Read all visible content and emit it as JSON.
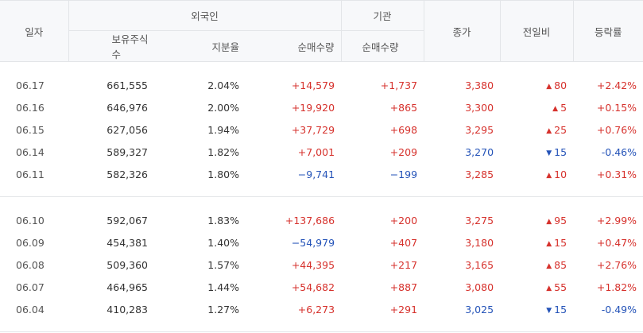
{
  "header": {
    "date": "일자",
    "foreign": "외국인",
    "institution": "기관",
    "close": "종가",
    "change": "전일비",
    "rate": "등락률",
    "holdings": "보유주식수",
    "share_ratio": "지분율",
    "foreign_net": "순매수량",
    "inst_net": "순매수량"
  },
  "colors": {
    "up": "#d6312c",
    "down": "#2453b8"
  },
  "icons": {
    "up": "triangle-up-icon",
    "down": "triangle-down-icon"
  },
  "groups": [
    {
      "rows": [
        {
          "date": "06.17",
          "holdings": "661,555",
          "ratio": "2.04%",
          "foreign_net": "+14,579",
          "fdir": "up",
          "inst_net": "+1,737",
          "idir": "up",
          "close": "3,380",
          "cdir": "up",
          "change": "80",
          "chdir": "up",
          "rate": "+2.42%",
          "rdir": "up"
        },
        {
          "date": "06.16",
          "holdings": "646,976",
          "ratio": "2.00%",
          "foreign_net": "+19,920",
          "fdir": "up",
          "inst_net": "+865",
          "idir": "up",
          "close": "3,300",
          "cdir": "up",
          "change": "5",
          "chdir": "up",
          "rate": "+0.15%",
          "rdir": "up"
        },
        {
          "date": "06.15",
          "holdings": "627,056",
          "ratio": "1.94%",
          "foreign_net": "+37,729",
          "fdir": "up",
          "inst_net": "+698",
          "idir": "up",
          "close": "3,295",
          "cdir": "up",
          "change": "25",
          "chdir": "up",
          "rate": "+0.76%",
          "rdir": "up"
        },
        {
          "date": "06.14",
          "holdings": "589,327",
          "ratio": "1.82%",
          "foreign_net": "+7,001",
          "fdir": "up",
          "inst_net": "+209",
          "idir": "up",
          "close": "3,270",
          "cdir": "down",
          "change": "15",
          "chdir": "down",
          "rate": "-0.46%",
          "rdir": "down"
        },
        {
          "date": "06.11",
          "holdings": "582,326",
          "ratio": "1.80%",
          "foreign_net": "−9,741",
          "fdir": "down",
          "inst_net": "−199",
          "idir": "down",
          "close": "3,285",
          "cdir": "up",
          "change": "10",
          "chdir": "up",
          "rate": "+0.31%",
          "rdir": "up"
        }
      ]
    },
    {
      "rows": [
        {
          "date": "06.10",
          "holdings": "592,067",
          "ratio": "1.83%",
          "foreign_net": "+137,686",
          "fdir": "up",
          "inst_net": "+200",
          "idir": "up",
          "close": "3,275",
          "cdir": "up",
          "change": "95",
          "chdir": "up",
          "rate": "+2.99%",
          "rdir": "up"
        },
        {
          "date": "06.09",
          "holdings": "454,381",
          "ratio": "1.40%",
          "foreign_net": "−54,979",
          "fdir": "down",
          "inst_net": "+407",
          "idir": "up",
          "close": "3,180",
          "cdir": "up",
          "change": "15",
          "chdir": "up",
          "rate": "+0.47%",
          "rdir": "up"
        },
        {
          "date": "06.08",
          "holdings": "509,360",
          "ratio": "1.57%",
          "foreign_net": "+44,395",
          "fdir": "up",
          "inst_net": "+217",
          "idir": "up",
          "close": "3,165",
          "cdir": "up",
          "change": "85",
          "chdir": "up",
          "rate": "+2.76%",
          "rdir": "up"
        },
        {
          "date": "06.07",
          "holdings": "464,965",
          "ratio": "1.44%",
          "foreign_net": "+54,682",
          "fdir": "up",
          "inst_net": "+887",
          "idir": "up",
          "close": "3,080",
          "cdir": "up",
          "change": "55",
          "chdir": "up",
          "rate": "+1.82%",
          "rdir": "up"
        },
        {
          "date": "06.04",
          "holdings": "410,283",
          "ratio": "1.27%",
          "foreign_net": "+6,273",
          "fdir": "up",
          "inst_net": "+291",
          "idir": "up",
          "close": "3,025",
          "cdir": "down",
          "change": "15",
          "chdir": "down",
          "rate": "-0.49%",
          "rdir": "down"
        }
      ]
    }
  ]
}
